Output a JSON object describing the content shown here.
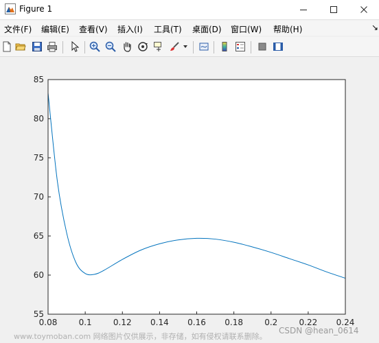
{
  "window": {
    "title": "Figure 1",
    "icons": {
      "app": "matlab-figure-icon",
      "minimize": "minimize-icon",
      "maximize": "maximize-icon",
      "close": "close-icon"
    }
  },
  "menu": {
    "items": [
      "文件(F)",
      "编辑(E)",
      "查看(V)",
      "插入(I)",
      "工具(T)",
      "桌面(D)",
      "窗口(W)",
      "帮助(H)"
    ],
    "pin_icon": "dock-arrow-icon"
  },
  "toolbar": {
    "icons": [
      "new-figure-icon",
      "open-file-icon",
      "save-icon",
      "print-icon",
      "pointer-icon",
      "zoom-in-icon",
      "zoom-out-icon",
      "pan-hand-icon",
      "rotate-3d-icon",
      "data-cursor-icon",
      "brush-icon",
      "link-plot-icon",
      "colorbar-icon",
      "legend-icon",
      "hide-plot-tools-icon",
      "show-plot-tools-icon"
    ]
  },
  "chart_data": {
    "type": "line",
    "title": "",
    "xlabel": "",
    "ylabel": "",
    "xlim": [
      0.08,
      0.24
    ],
    "ylim": [
      55,
      85
    ],
    "x_ticks": [
      "0.08",
      "0.1",
      "0.12",
      "0.14",
      "0.16",
      "0.18",
      "0.2",
      "0.22",
      "0.24"
    ],
    "y_ticks": [
      "55",
      "60",
      "65",
      "70",
      "75",
      "80",
      "85"
    ],
    "grid": false,
    "line_color": "#0072bd",
    "series": [
      {
        "x": [
          0.08,
          0.085,
          0.09,
          0.095,
          0.1,
          0.105,
          0.11,
          0.12,
          0.13,
          0.14,
          0.15,
          0.16,
          0.17,
          0.18,
          0.19,
          0.2,
          0.21,
          0.22,
          0.23,
          0.24
        ],
        "values": [
          83.3,
          72.0,
          65.4,
          61.6,
          60.2,
          60.1,
          60.6,
          62.0,
          63.2,
          64.0,
          64.5,
          64.7,
          64.6,
          64.2,
          63.6,
          62.9,
          62.1,
          61.3,
          60.4,
          59.6
        ]
      }
    ]
  },
  "watermark": {
    "left": "www.toymoban.com 网络图片仅供展示，非存储，如有侵权请联系删除。",
    "right": "CSDN @hean_0614"
  }
}
